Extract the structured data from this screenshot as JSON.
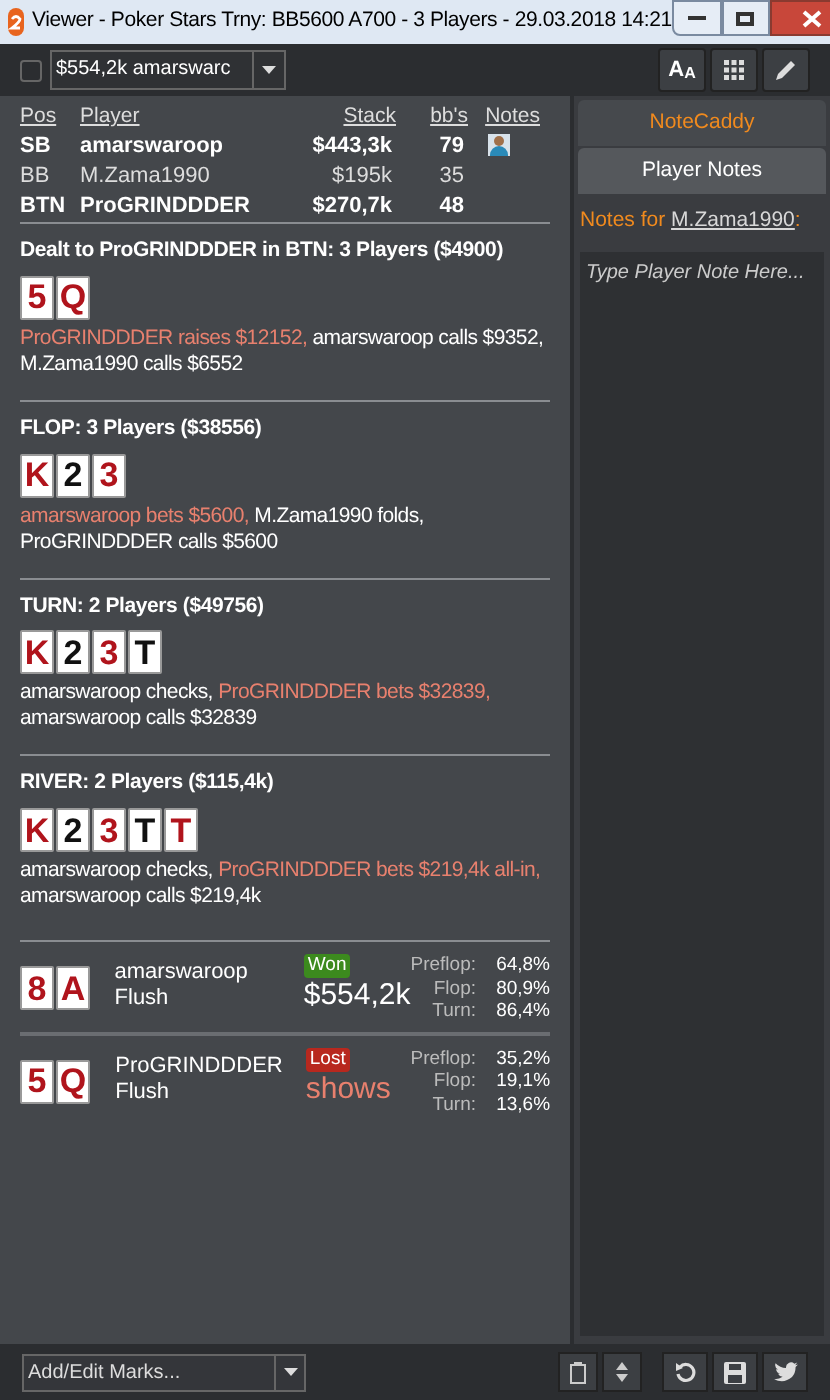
{
  "window": {
    "title": "Viewer - Poker Stars Trny: BB5600 A700 - 3 Players - 29.03.2018 14:21"
  },
  "toolbar": {
    "checked": false,
    "hand_select": "$554,2k amarswarc",
    "font_button": [
      "A",
      "A"
    ]
  },
  "players": {
    "columns": [
      "Pos",
      "Player",
      "Stack",
      "bb's",
      "Notes"
    ],
    "rows": [
      {
        "pos": "SB",
        "player": "amarswaroop",
        "stack": "$443,3k",
        "bbs": "79",
        "bold": true,
        "has_note": true
      },
      {
        "pos": "BB",
        "player": "M.Zama1990",
        "stack": "$195k",
        "bbs": "35",
        "bold": false,
        "has_note": false
      },
      {
        "pos": "BTN",
        "player": "ProGRINDDDER",
        "stack": "$270,7k",
        "bbs": "48",
        "bold": true,
        "has_note": false
      }
    ]
  },
  "streets": [
    {
      "heading": "Dealt to ProGRINDDDER in BTN: 3 Players ($4900)",
      "cards": [
        {
          "rank": "5",
          "color": "#b0141c"
        },
        {
          "rank": "Q",
          "color": "#b0141c"
        }
      ],
      "actions": [
        {
          "text": "ProGRINDDDER raises $12152,",
          "hero": true
        },
        {
          "text": "amarswaroop calls $9352,",
          "hero": false
        },
        {
          "text": "M.Zama1990 calls $6552",
          "hero": false
        }
      ]
    },
    {
      "heading": "FLOP: 3 Players ($38556)",
      "cards": [
        {
          "rank": "K",
          "color": "#b0141c"
        },
        {
          "rank": "2",
          "color": "#111111"
        },
        {
          "rank": "3",
          "color": "#b0141c"
        }
      ],
      "actions": [
        {
          "text": "amarswaroop bets $5600,",
          "hero": true
        },
        {
          "text": "M.Zama1990 folds,",
          "hero": false
        },
        {
          "text": "ProGRINDDDER calls $5600",
          "hero": false
        }
      ]
    },
    {
      "heading": "TURN: 2 Players ($49756)",
      "cards": [
        {
          "rank": "K",
          "color": "#b0141c"
        },
        {
          "rank": "2",
          "color": "#111111"
        },
        {
          "rank": "3",
          "color": "#b0141c"
        },
        {
          "rank": "T",
          "color": "#111111"
        }
      ],
      "actions": [
        {
          "text": "amarswaroop checks,",
          "hero": false
        },
        {
          "text": "ProGRINDDDER bets $32839,",
          "hero": true
        },
        {
          "text": "amarswaroop calls $32839",
          "hero": false
        }
      ]
    },
    {
      "heading": "RIVER: 2 Players ($115,4k)",
      "cards": [
        {
          "rank": "K",
          "color": "#b0141c"
        },
        {
          "rank": "2",
          "color": "#111111"
        },
        {
          "rank": "3",
          "color": "#b0141c"
        },
        {
          "rank": "T",
          "color": "#111111"
        },
        {
          "rank": "T",
          "color": "#b0141c"
        }
      ],
      "actions": [
        {
          "text": "amarswaroop checks,",
          "hero": false
        },
        {
          "text": "ProGRINDDDER bets $219,4k all-in,",
          "hero": true
        },
        {
          "text": "amarswaroop calls $219,4k",
          "hero": false
        }
      ]
    }
  ],
  "results": [
    {
      "cards": [
        {
          "rank": "8",
          "color": "#b0141c"
        },
        {
          "rank": "A",
          "color": "#b0141c"
        }
      ],
      "player": "amarswaroop",
      "hand": "Flush",
      "badge": {
        "label": "Won",
        "kind": "won"
      },
      "amount": "$554,2k",
      "equity": [
        {
          "street": "Preflop:",
          "value": "64,8%"
        },
        {
          "street": "Flop:",
          "value": "80,9%"
        },
        {
          "street": "Turn:",
          "value": "86,4%"
        }
      ]
    },
    {
      "cards": [
        {
          "rank": "5",
          "color": "#b0141c"
        },
        {
          "rank": "Q",
          "color": "#b0141c"
        }
      ],
      "player": "ProGRINDDDER",
      "hand": "Flush",
      "badge": {
        "label": "Lost",
        "kind": "lost"
      },
      "amount": "shows",
      "equity": [
        {
          "street": "Preflop:",
          "value": "35,2%"
        },
        {
          "street": "Flop:",
          "value": "19,1%"
        },
        {
          "street": "Turn:",
          "value": "13,6%"
        }
      ]
    }
  ],
  "side_panel": {
    "tabs": [
      {
        "label": "NoteCaddy",
        "selected": false
      },
      {
        "label": "Player Notes",
        "selected": true
      }
    ],
    "notes_label": "Notes for",
    "notes_player": "M.Zama1990",
    "notes_colon": ":",
    "note_placeholder": "Type Player Note Here..."
  },
  "bottom": {
    "marks_placeholder": "Add/Edit Marks..."
  }
}
